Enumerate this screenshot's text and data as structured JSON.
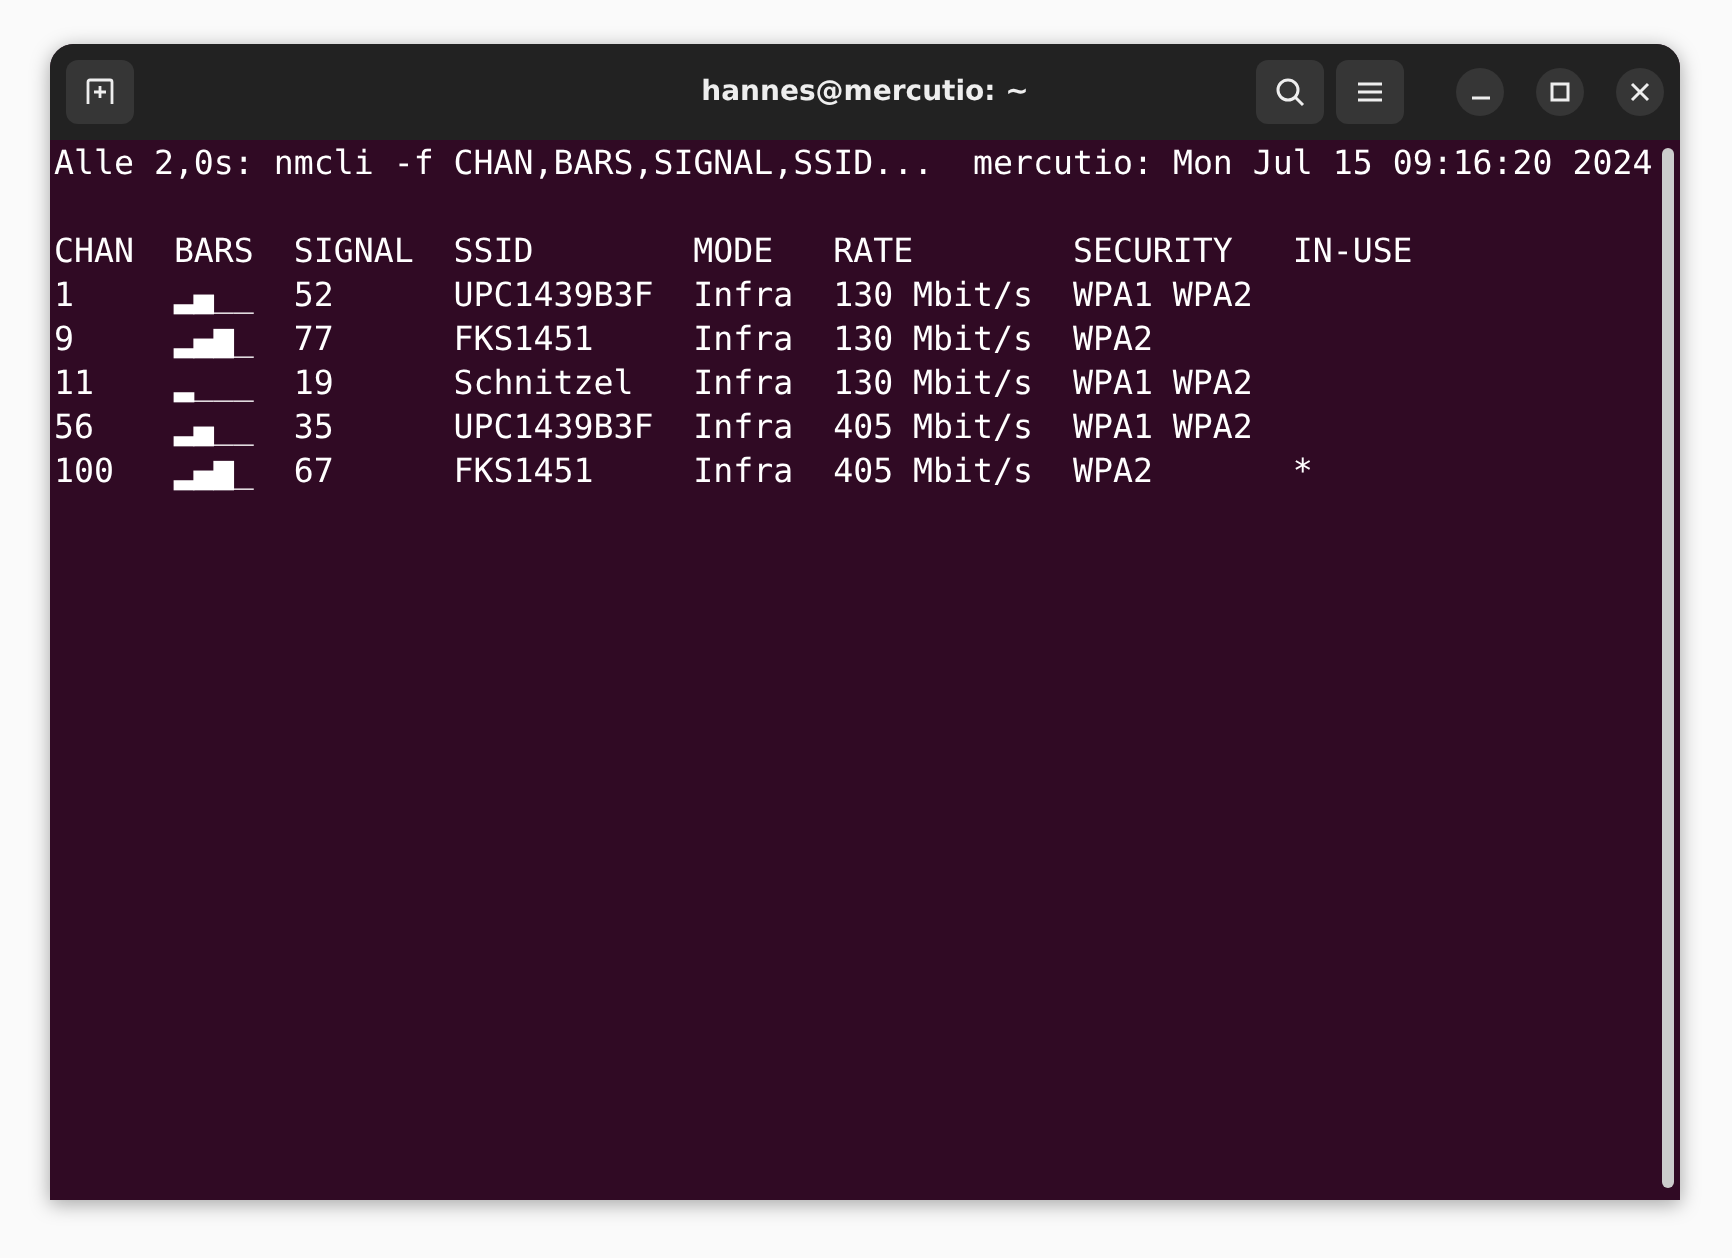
{
  "window": {
    "title": "hannes@mercutio: ~"
  },
  "terminal": {
    "command": "Alle 2,0s: nmcli -f CHAN,BARS,SIGNAL,SSID...",
    "host_time": "mercutio: Mon Jul 15 09:16:20 2024",
    "columns": [
      "CHAN",
      "BARS",
      "SIGNAL",
      "SSID",
      "MODE",
      "RATE",
      "SECURITY",
      "IN-USE"
    ],
    "rows": [
      {
        "chan": "1",
        "bars": "▂▄__",
        "signal": "52",
        "ssid": "UPC1439B3F",
        "mode": "Infra",
        "rate": "130 Mbit/s",
        "security": "WPA1 WPA2"
      },
      {
        "chan": "9",
        "bars": "▂▄▆_",
        "signal": "77",
        "ssid": "FKS1451",
        "mode": "Infra",
        "rate": "130 Mbit/s",
        "security": "WPA2"
      },
      {
        "chan": "11",
        "bars": "▂___",
        "signal": "19",
        "ssid": "Schnitzel",
        "mode": "Infra",
        "rate": "130 Mbit/s",
        "security": "WPA1 WPA2"
      },
      {
        "chan": "56",
        "bars": "▂▄__",
        "signal": "35",
        "ssid": "UPC1439B3F",
        "mode": "Infra",
        "rate": "405 Mbit/s",
        "security": "WPA1 WPA2"
      },
      {
        "chan": "100",
        "bars": "▂▄▆_",
        "signal": "67",
        "ssid": "FKS1451",
        "mode": "Infra",
        "rate": "405 Mbit/s",
        "security": "WPA2",
        "in_use": "*"
      }
    ]
  }
}
